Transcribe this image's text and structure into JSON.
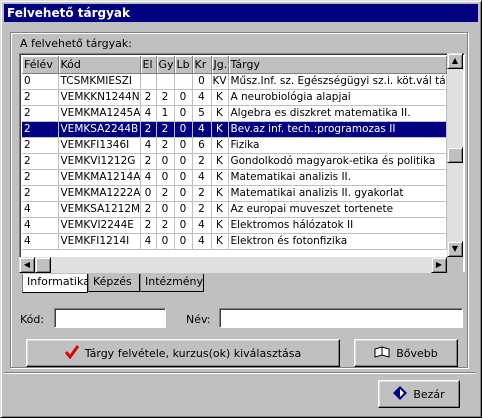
{
  "window": {
    "title": "Felvehető tárgyak"
  },
  "group": {
    "label": "A felvehető tárgyak:"
  },
  "table": {
    "columns": [
      "Félév",
      "Kód",
      "El",
      "Gy",
      "Lb",
      "Kr",
      "Jg.",
      "Tárgy"
    ],
    "rows": [
      [
        "0",
        "TCSMKMIESZI",
        "",
        "",
        "",
        "0",
        "KV",
        "Műsz.Inf. sz. Egészségügyi sz.i. köt.vál tárgya"
      ],
      [
        "2",
        "VEMKKN1244N",
        "2",
        "2",
        "0",
        "4",
        "K",
        "A neurobiológia alapjai"
      ],
      [
        "2",
        "VEMKMA1245A",
        "4",
        "1",
        "0",
        "5",
        "K",
        "Algebra es diszkret matematika II."
      ],
      [
        "2",
        "VEMKSA2244B",
        "2",
        "2",
        "0",
        "4",
        "K",
        "Bev.az inf. tech.:programozas  II"
      ],
      [
        "2",
        "VEMKFI1346I",
        "4",
        "2",
        "0",
        "6",
        "K",
        "Fizika"
      ],
      [
        "2",
        "VEMKVI1212G",
        "2",
        "0",
        "0",
        "2",
        "K",
        "Gondolkodó magyarok-etika és politika"
      ],
      [
        "2",
        "VEMKMA1214A",
        "4",
        "0",
        "0",
        "4",
        "K",
        "Matematikai analizis II."
      ],
      [
        "2",
        "VEMKMA1222A",
        "0",
        "2",
        "0",
        "2",
        "K",
        "Matematikai analizis II. gyakorlat"
      ],
      [
        "4",
        "VEMKSA1212M",
        "2",
        "0",
        "0",
        "2",
        "K",
        "Az europai muveszet tortenete"
      ],
      [
        "4",
        "VEMKVI2244E",
        "2",
        "2",
        "0",
        "4",
        "K",
        "Elektromos hálózatok II"
      ],
      [
        "4",
        "VEMKFI1214I",
        "4",
        "0",
        "0",
        "4",
        "K",
        "Elektron és fotonfizika"
      ]
    ],
    "selected_row": 3
  },
  "tabs": [
    "Informatika",
    "Képzés",
    "Intézmény"
  ],
  "form": {
    "kod_label": "Kód:",
    "kod_value": "",
    "nev_label": "Név:",
    "nev_value": ""
  },
  "buttons": {
    "targy_felvetele": "Tárgy felvétele, kurzus(ok) kiválasztása",
    "bovebb": "Bővebb",
    "bezar": "Bezár"
  },
  "colors": {
    "selection": "#000080",
    "check_icon": "#e00000",
    "close_icon": "#000080"
  }
}
